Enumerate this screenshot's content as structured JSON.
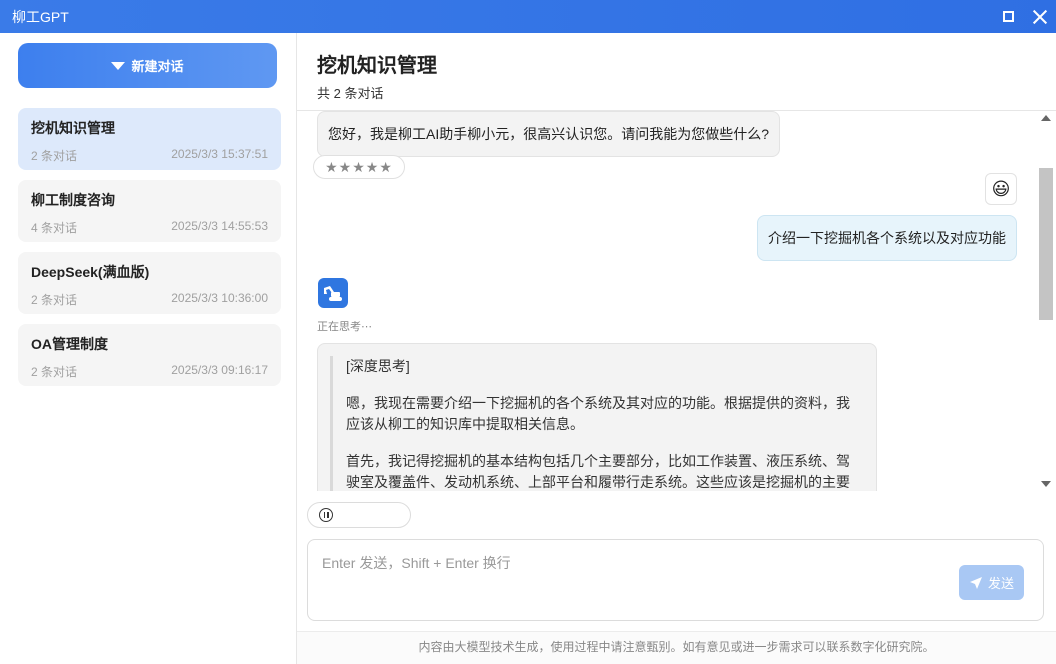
{
  "window": {
    "title": "柳工GPT"
  },
  "sidebar": {
    "new_chat_label": "新建对话",
    "conversations": [
      {
        "title": "挖机知识管理",
        "count": "2 条对话",
        "time": "2025/3/3 15:37:51",
        "active": true
      },
      {
        "title": "柳工制度咨询",
        "count": "4 条对话",
        "time": "2025/3/3 14:55:53"
      },
      {
        "title": "DeepSeek(满血版)",
        "count": "2 条对话",
        "time": "2025/3/3 10:36:00"
      },
      {
        "title": "OA管理制度",
        "count": "2 条对话",
        "time": "2025/3/3 09:16:17"
      }
    ]
  },
  "chat": {
    "title": "挖机知识管理",
    "subtitle": "共 2 条对话",
    "bot_greeting": "您好，我是柳工AI助手柳小元，很高兴认识您。请问我能为您做些什么?",
    "rating": "★★★★★",
    "user_avatar": "😃",
    "user_message": "介绍一下挖掘机各个系统以及对应功能",
    "thinking_label": "正在思考⋯",
    "think_heading": "[深度思考]",
    "think_p1": "嗯，我现在需要介绍一下挖掘机的各个系统及其对应的功能。根据提供的资料，我应该从柳工的知识库中提取相关信息。",
    "think_p2": "首先，我记得挖掘机的基本结构包括几个主要部分，比如工作装置、液压系统、驾驶室及覆盖件、发动机系统、上部平台和履带行走系统。这些应该是挖掘机的主要"
  },
  "composer": {
    "placeholder": "Enter 发送，Shift + Enter 换行",
    "send_label": "发送"
  },
  "footer": {
    "disclaimer": "内容由大模型技术生成，使用过程中请注意甄别。如有意见或进一步需求可以联系数字化研究院。"
  },
  "colors": {
    "accent": "#2f6fe3",
    "active_item": "#dde9fb",
    "user_bubble": "#e7f4fb",
    "send_disabled": "#a9c8f4"
  }
}
